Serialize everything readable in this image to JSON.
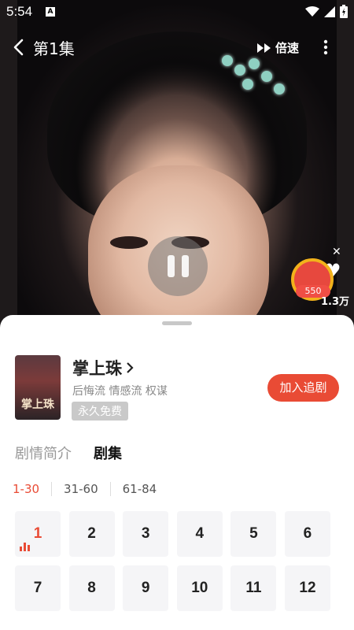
{
  "status_bar": {
    "time": "5:54",
    "app_badge": "A"
  },
  "top_bar": {
    "episode_title": "第1集",
    "speed_label": "倍速"
  },
  "reward": {
    "coins": "550",
    "like_count": "1.3万"
  },
  "drama": {
    "title": "掌上珠",
    "poster_text": "掌上珠",
    "tags": "后悔流 情感流 权谋",
    "free_badge": "永久免费",
    "follow_label": "加入追剧"
  },
  "tabs": [
    {
      "label": "剧情简介",
      "active": false
    },
    {
      "label": "剧集",
      "active": true
    }
  ],
  "ranges": [
    {
      "label": "1-30",
      "active": true
    },
    {
      "label": "31-60",
      "active": false
    },
    {
      "label": "61-84",
      "active": false
    }
  ],
  "episodes": [
    "1",
    "2",
    "3",
    "4",
    "5",
    "6",
    "7",
    "8",
    "9",
    "10",
    "11",
    "12"
  ],
  "current_episode": "1",
  "colors": {
    "accent": "#e94b35",
    "badge_gray": "#c9c9c9"
  }
}
